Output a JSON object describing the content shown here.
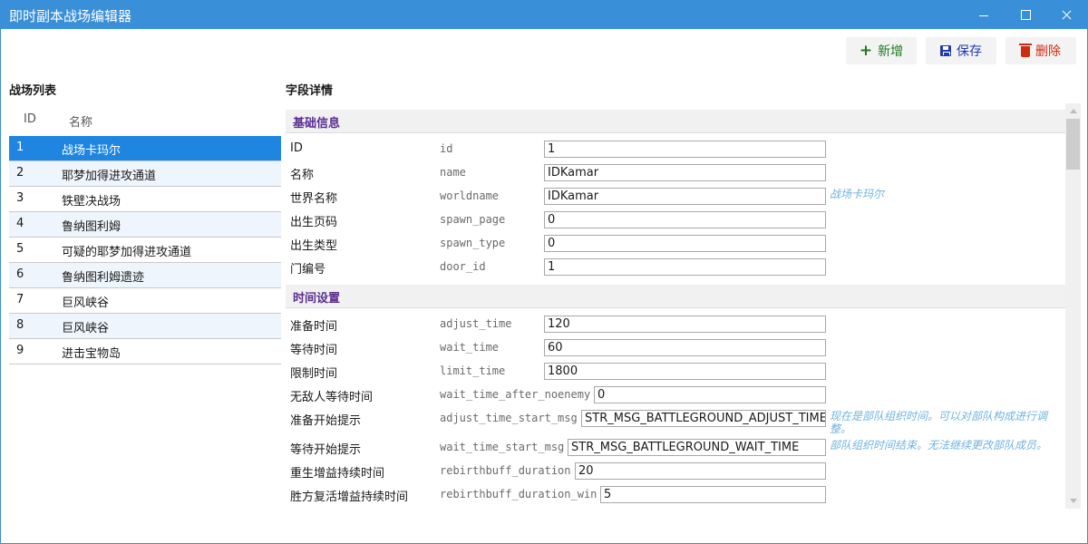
{
  "window": {
    "title": "即时副本战场编辑器"
  },
  "toolbar": {
    "add_label": "新增",
    "save_label": "保存",
    "delete_label": "删除"
  },
  "list_panel": {
    "heading": "战场列表",
    "columns": {
      "id": "ID",
      "name": "名称"
    },
    "selected_index": 0,
    "rows": [
      {
        "id": "1",
        "name": "战场卡玛尔"
      },
      {
        "id": "2",
        "name": "耶梦加得进攻通道"
      },
      {
        "id": "3",
        "name": "铁壁决战场"
      },
      {
        "id": "4",
        "name": "鲁纳图利姆"
      },
      {
        "id": "5",
        "name": "可疑的耶梦加得进攻通道"
      },
      {
        "id": "6",
        "name": "鲁纳图利姆遗迹"
      },
      {
        "id": "7",
        "name": "巨风峡谷"
      },
      {
        "id": "8",
        "name": "巨风峡谷"
      },
      {
        "id": "9",
        "name": "进击宝物岛"
      }
    ]
  },
  "detail_panel": {
    "heading": "字段详情",
    "groups": [
      {
        "title": "基础信息",
        "fields": [
          {
            "label": "ID",
            "key": "id",
            "value": "1",
            "note": ""
          },
          {
            "label": "名称",
            "key": "name",
            "value": "IDKamar",
            "note": ""
          },
          {
            "label": "世界名称",
            "key": "worldname",
            "value": "IDKamar",
            "note": "战场卡玛尔"
          },
          {
            "label": "出生页码",
            "key": "spawn_page",
            "value": "0",
            "note": ""
          },
          {
            "label": "出生类型",
            "key": "spawn_type",
            "value": "0",
            "note": ""
          },
          {
            "label": "门编号",
            "key": "door_id",
            "value": "1",
            "note": ""
          }
        ]
      },
      {
        "title": "时间设置",
        "fields": [
          {
            "label": "准备时间",
            "key": "adjust_time",
            "value": "120",
            "note": ""
          },
          {
            "label": "等待时间",
            "key": "wait_time",
            "value": "60",
            "note": ""
          },
          {
            "label": "限制时间",
            "key": "limit_time",
            "value": "1800",
            "note": ""
          },
          {
            "label": "无敌人等待时间",
            "key": "wait_time_after_noenemy",
            "value": "0",
            "note": ""
          },
          {
            "label": "准备开始提示",
            "key": "adjust_time_start_msg",
            "value": "STR_MSG_BATTLEGROUND_ADJUST_TIME",
            "note": "现在是部队组织时间。可以对部队构成进行调整。"
          },
          {
            "label": "等待开始提示",
            "key": "wait_time_start_msg",
            "value": "STR_MSG_BATTLEGROUND_WAIT_TIME",
            "note": "部队组织时间结束。无法继续更改部队成员。"
          },
          {
            "label": "重生增益持续时间",
            "key": "rebirthbuff_duration",
            "value": "20",
            "note": ""
          },
          {
            "label": "胜方复活增益持续时间",
            "key": "rebirthbuff_duration_win",
            "value": "5",
            "note": ""
          }
        ]
      }
    ]
  }
}
